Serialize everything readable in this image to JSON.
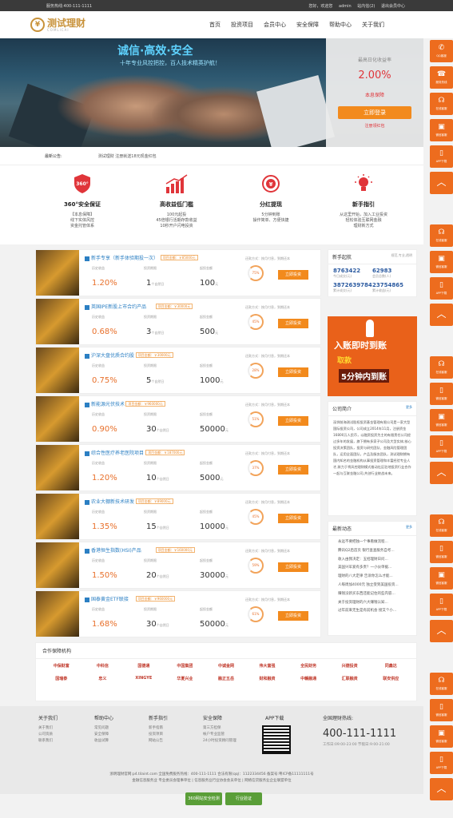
{
  "topbar": {
    "hotline": "服务热线:400-111-1111",
    "links": [
      "您好，欢迎您",
      "admin",
      "站内信(2)",
      "退出会员中心"
    ]
  },
  "logo": {
    "name": "测试理财",
    "sub": "COMLICAI"
  },
  "nav": [
    "首页",
    "投资项目",
    "会员中心",
    "安全保障",
    "帮助中心",
    "关于我们"
  ],
  "hero": {
    "slogan": "诚信·高效·安全",
    "sub": "十年专业风控把控，百人技术精英护航！",
    "rate_label": "最高日化收益率",
    "rate": "2.00%",
    "guarantee": "本息保障",
    "login_button": "立即登录",
    "register_link": "注册领红包"
  },
  "notice": {
    "label": "最新公告:",
    "text": "测试理财 注册就送18元现金红包"
  },
  "features": [
    {
      "icon": "360",
      "title": "360°安全保证",
      "desc": [
        "【本息保障】",
        "线下实体风控",
        "资金托管体系"
      ]
    },
    {
      "icon": "chart",
      "title": "高收益低门槛",
      "desc": [
        "100元起投",
        "45倍银行活期存款收益",
        "10秒开户闪电投资"
      ]
    },
    {
      "icon": "¥",
      "title": "分红提现",
      "desc": [
        "5分钟到账",
        "操作简单、方便快捷"
      ]
    },
    {
      "icon": "bulb",
      "title": "新手指引",
      "desc": [
        "从这里开始，加入工业投资",
        "轻松体验互联网金融",
        "理财新方式"
      ]
    }
  ],
  "product_captions": {
    "rate": "历史收益",
    "period": "投资期限",
    "min": "起投金额",
    "repay": "还款方式：按月付息，到期还本",
    "invest": "立即投资",
    "unit_period": "个自然日",
    "unit_money": "元"
  },
  "products": [
    {
      "name": "新手专享（新手体验期投一次）",
      "amount": "项目金额：￥85000元",
      "rate": "1.20%",
      "days": "1",
      "min": "100",
      "progress": "75%"
    },
    {
      "name": "英国IPE新股上市合约产品",
      "amount": "项目金额：￥30000元",
      "rate": "0.68%",
      "days": "3",
      "min": "500",
      "progress": "45%"
    },
    {
      "name": "沪深大盘优质合约股",
      "amount": "项目金额：￥30000元",
      "rate": "0.75%",
      "days": "5",
      "min": "1000",
      "progress": "28%"
    },
    {
      "name": "新能源光伏技术",
      "amount": "项目金额：￥960000元",
      "rate": "0.90%",
      "days": "30",
      "min": "50000",
      "progress": "51%"
    },
    {
      "name": "综合性医疗养老医院项目",
      "amount": "项目金额：￥187000元",
      "rate": "1.20%",
      "days": "10",
      "min": "5000",
      "progress": "37%"
    },
    {
      "name": "农业大棚新技术研发",
      "amount": "项目金额：￥89000元",
      "rate": "1.35%",
      "days": "15",
      "min": "10000",
      "progress": "45%"
    },
    {
      "name": "香港恒生指数(HSI)产品",
      "amount": "项目金额：￥160000元",
      "rate": "1.50%",
      "days": "20",
      "min": "30000",
      "progress": "59%"
    },
    {
      "name": "国泰黄金ETF联接",
      "amount": "项目金额：￥960000元",
      "rate": "1.68%",
      "days": "30",
      "min": "50000",
      "progress": "61%"
    }
  ],
  "sidebox": {
    "title": "新手起航",
    "sub": "规范,专业,透明",
    "stats": [
      {
        "n": "8763422",
        "c": "今日成交(元)"
      },
      {
        "n": "62983",
        "c": "会员总数(人)"
      },
      {
        "n": "3872639784",
        "c": "累计成交(元)"
      },
      {
        "n": "23754865",
        "c": "累计收益(元)"
      }
    ]
  },
  "promo": {
    "a": "入账即时到账",
    "b": "取款",
    "c": "5分钟内到账"
  },
  "intro": {
    "title": "公司简介",
    "more": "更多",
    "text": "深圳前海测试股权投资基金管理有限公司是一家大型国际投资公司，公司成立2014年11月，注册资金16800万人民币，以融资投资为主的有限责任公司经过多年的发展，旗下拥有多家子公司及大型实体;核心投资决策团队，投资与研究团队、金融风险管理团队，运用全面团队，产品及服务团队，测试理财拥有国内知名的金融机构从事投资管理和丰富经验专业人才,致力于将风控理财模式推动社区驻地投资行业合作一起与互联金融公司,共创行业统战未来。"
  },
  "news": {
    "title": "最新动态",
    "more": "更多",
    "items": [
      "永远不要把独一个事看做流程...",
      "腾讯Q2后首页 银行查查服务自考...",
      "收入由我决定：五招理财日问...",
      "美国兴军爱有多贵？一小伙单据...",
      "理财的八大定律 告诉你怎么才能...",
      "人每周加4000元 独立受到美国投资...",
      "赚钱没新买东西还能记住的些内容...",
      "关于投资理财的六大赚钱认知...",
      "过年前来无生是有前机会 接又个小..."
    ]
  },
  "partners": {
    "title": "合作保障机构",
    "logos": [
      "中保财富",
      "中科信",
      "国德通",
      "中国集团",
      "中诚金网",
      "伟大富强",
      "全民财务",
      "兴德投资",
      "同鑫达",
      "国瑞泰",
      "忠义",
      "XINGYE",
      "华夏兴业",
      "融正五岳",
      "财和融资",
      "中赣融通",
      "汇联融资",
      "联安供应"
    ]
  },
  "footer": {
    "cols": [
      {
        "title": "关于我们",
        "items": [
          "关于我们",
          "公司资质",
          "联系我们"
        ]
      },
      {
        "title": "帮助中心",
        "items": [
          "常见问题",
          "安全保障",
          "收益试算"
        ]
      },
      {
        "title": "新手指引",
        "items": [
          "新手指南",
          "投资项目",
          "网站公告"
        ]
      },
      {
        "title": "安全保障",
        "items": [
          "第三方担保",
          "帐户专业监管",
          "24小时投资顾问管理"
        ]
      }
    ],
    "app": "APP下载",
    "hotline_title": "全国理财热线:",
    "hotline": "400-111-1111",
    "hours": "工作日:09:00-23:00 节假日:9:00-21:00",
    "copy1": "浙明理财官网:p4.tilaint.com 全国免费服务热线：400-111-1111 合法有限(qq)：1122334456 备案号:粤ICP备11111111号",
    "copy2": "金融信息服务业 专业委员会理事单位 | 信息服务业行业协会会员单位 | 网络信贷服务业企业联盟单位",
    "badge1": "360网站安全检测",
    "badge2": "行业验证"
  },
  "rightbar": [
    {
      "g": "✆",
      "l": "QQ客服"
    },
    {
      "g": "☎",
      "l": "服务热线"
    },
    {
      "g": "☊",
      "l": "在线客服"
    },
    {
      "g": "▣",
      "l": "微信客服"
    },
    {
      "g": "▯",
      "l": "APP下载"
    },
    {
      "g": "︿",
      "l": ""
    },
    {
      "g": "☊",
      "l": "在线客服"
    },
    {
      "g": "▣",
      "l": "微信客服"
    },
    {
      "g": "▯",
      "l": "APP下载"
    },
    {
      "g": "︿",
      "l": ""
    },
    {
      "g": "☊",
      "l": "在线客服"
    },
    {
      "g": "▯",
      "l": "微信客服"
    },
    {
      "g": "▣",
      "l": "微信客服"
    },
    {
      "g": "▯",
      "l": "APP下载"
    },
    {
      "g": "︿",
      "l": ""
    },
    {
      "g": "☊",
      "l": "在线客服"
    },
    {
      "g": "▯",
      "l": "微信客服"
    },
    {
      "g": "▣",
      "l": "微信客服"
    },
    {
      "g": "▯",
      "l": "APP下载"
    },
    {
      "g": "︿",
      "l": ""
    },
    {
      "g": "☊",
      "l": "在线客服"
    },
    {
      "g": "▯",
      "l": "微信客服"
    },
    {
      "g": "▣",
      "l": "微信客服"
    },
    {
      "g": "▯",
      "l": "APP下载"
    },
    {
      "g": "︿",
      "l": ""
    }
  ],
  "colors": {
    "accent": "#f28a1d",
    "rate": "#e0353a",
    "link": "#2b7fc3"
  }
}
